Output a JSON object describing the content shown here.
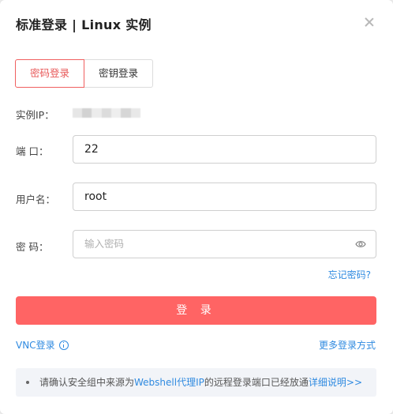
{
  "dialog": {
    "title": "标准登录 | Linux 实例"
  },
  "tabs": [
    {
      "label": "密码登录",
      "active": true
    },
    {
      "label": "密钥登录",
      "active": false
    }
  ],
  "form": {
    "ip_label": "实例IP：",
    "port_label": "端 口：",
    "port_value": "22",
    "username_label": "用户名：",
    "username_value": "root",
    "password_label": "密 码：",
    "password_placeholder": "输入密码",
    "forgot_password": "忘记密码?"
  },
  "login_button": "登 录",
  "links": {
    "vnc_login": "VNC登录",
    "more_methods": "更多登录方式"
  },
  "notice": {
    "text_before": "请确认安全组中来源为",
    "highlight_1": "Webshell代理IP",
    "text_middle": "的远程登录端口已经放通",
    "highlight_2": "详细说明>>"
  },
  "colors": {
    "accent": "#ff6464",
    "link": "#2f8ae0"
  }
}
